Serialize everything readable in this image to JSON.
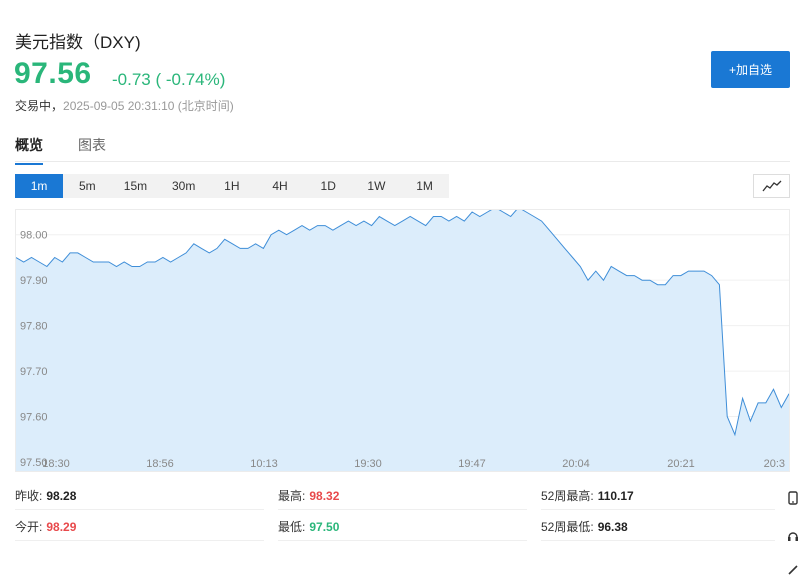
{
  "header": {
    "title": "美元指数（DXY)",
    "price": "97.56",
    "change": "-0.73 ( -0.74%)",
    "status_label": "交易中，",
    "timestamp": "2025-09-05 20:31:10 (北京时间)",
    "add_button": "+加自选",
    "accent_color": "#1a78d4",
    "down_color": "#2ab67a",
    "up_color": "#e8494b"
  },
  "tabs": [
    {
      "label": "概览",
      "active": true
    },
    {
      "label": "图表",
      "active": false
    }
  ],
  "ranges": [
    "1m",
    "5m",
    "15m",
    "30m",
    "1H",
    "4H",
    "1D",
    "1W",
    "1M"
  ],
  "active_range": "1m",
  "chart_type_icon": "line-chart-icon",
  "chart_data": {
    "type": "area",
    "x_ticks": [
      "18:30",
      "18:56",
      "10:13",
      "19:30",
      "19:47",
      "20:04",
      "20:21",
      "20:3"
    ],
    "y_ticks": [
      "98.00",
      "97.90",
      "97.80",
      "97.70",
      "97.60",
      "97.50"
    ],
    "ylim": [
      97.5,
      98.05
    ],
    "grid": true,
    "fill_color": "#dcedfb",
    "line_color": "#3f8ed8",
    "values": [
      97.95,
      97.94,
      97.95,
      97.94,
      97.93,
      97.95,
      97.94,
      97.96,
      97.96,
      97.95,
      97.94,
      97.94,
      97.94,
      97.93,
      97.94,
      97.93,
      97.93,
      97.94,
      97.94,
      97.95,
      97.94,
      97.95,
      97.96,
      97.98,
      97.97,
      97.96,
      97.97,
      97.99,
      97.98,
      97.97,
      97.97,
      97.98,
      97.97,
      98.0,
      98.01,
      98.0,
      98.01,
      98.02,
      98.01,
      98.02,
      98.02,
      98.01,
      98.02,
      98.03,
      98.02,
      98.03,
      98.02,
      98.04,
      98.03,
      98.02,
      98.03,
      98.04,
      98.03,
      98.02,
      98.04,
      98.04,
      98.03,
      98.04,
      98.03,
      98.05,
      98.04,
      98.05,
      98.06,
      98.05,
      98.04,
      98.06,
      98.05,
      98.04,
      98.03,
      98.01,
      97.99,
      97.97,
      97.95,
      97.93,
      97.9,
      97.92,
      97.9,
      97.93,
      97.92,
      97.91,
      97.91,
      97.9,
      97.9,
      97.89,
      97.89,
      97.91,
      97.91,
      97.92,
      97.92,
      97.92,
      97.91,
      97.89,
      97.6,
      97.56,
      97.64,
      97.59,
      97.63,
      97.63,
      97.66,
      97.62,
      97.65
    ]
  },
  "stats": [
    {
      "label": "昨收:",
      "value": "98.28",
      "tone": "black"
    },
    {
      "label": "最高:",
      "value": "98.32",
      "tone": "red"
    },
    {
      "label": "52周最高:",
      "value": "110.17",
      "tone": "black"
    },
    {
      "label": "今开:",
      "value": "98.29",
      "tone": "red"
    },
    {
      "label": "最低:",
      "value": "97.50",
      "tone": "green"
    },
    {
      "label": "52周最低:",
      "value": "96.38",
      "tone": "black"
    }
  ],
  "side_icons": [
    "phone-icon",
    "headset-icon",
    "edit-icon"
  ]
}
